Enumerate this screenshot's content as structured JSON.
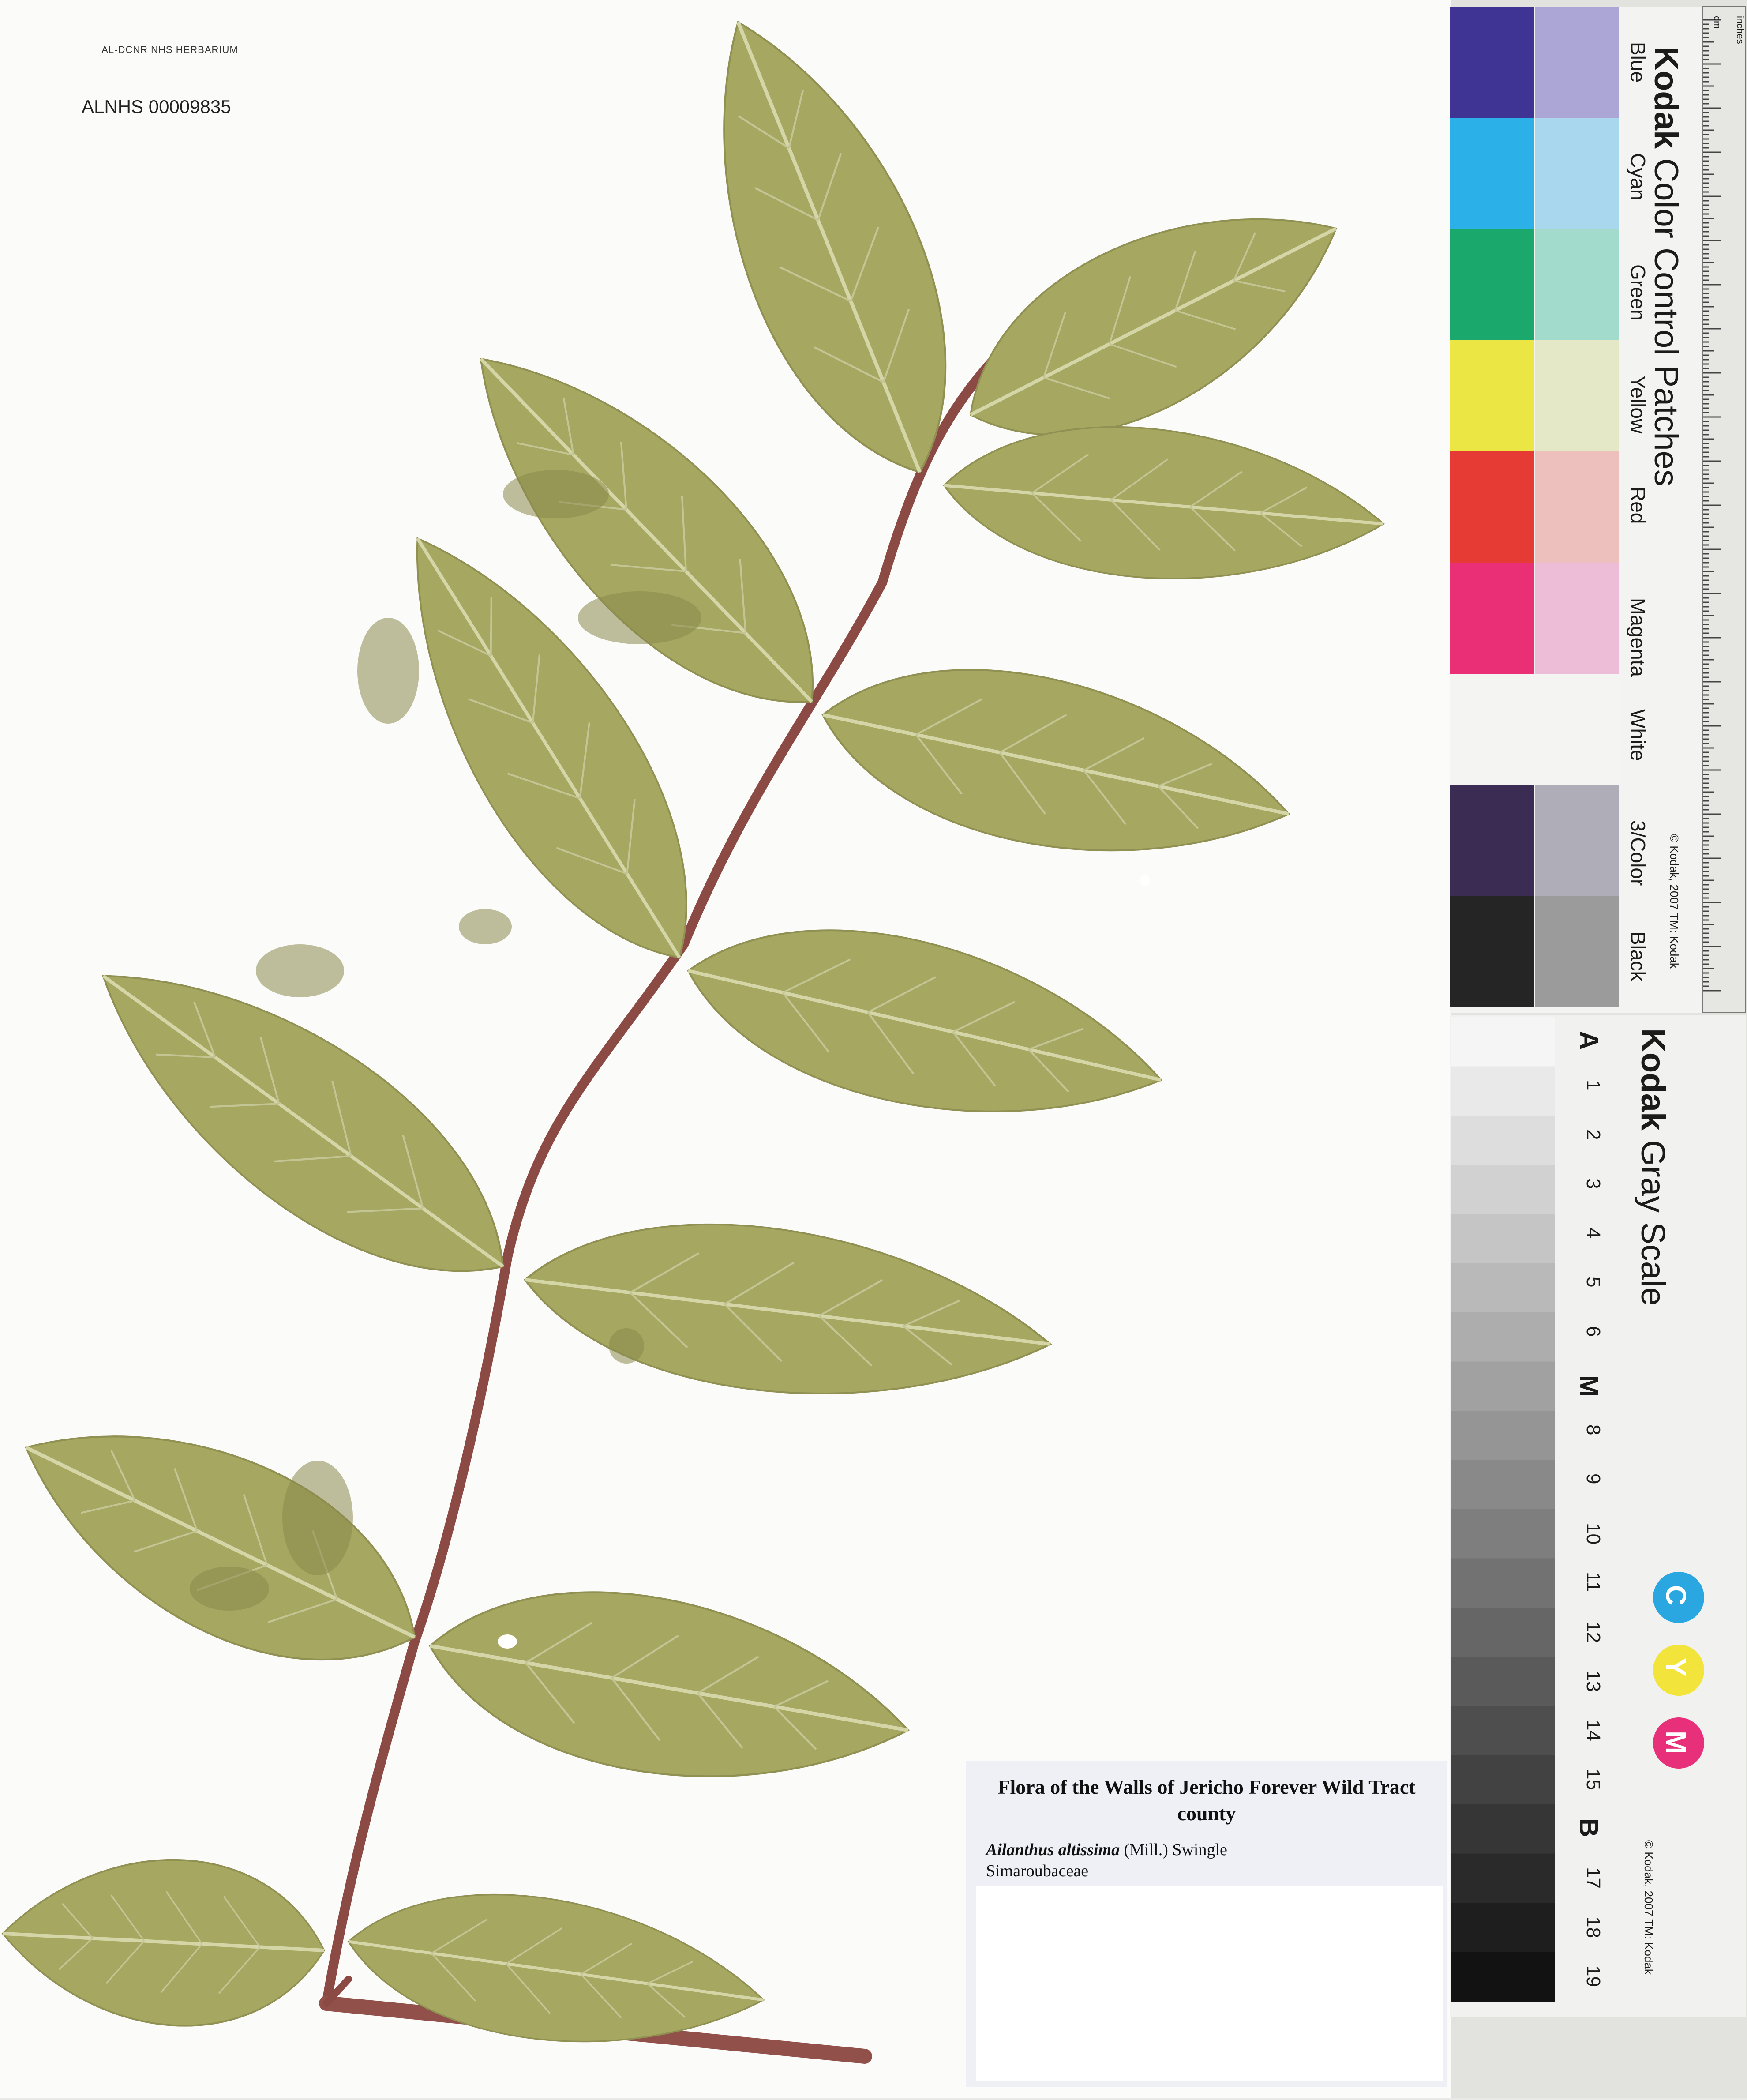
{
  "barcode": {
    "header": "AL-DCNR NHS HERBARIUM",
    "number": "ALNHS 00009835"
  },
  "label": {
    "title": "Flora of the Walls of Jericho Forever Wild Tract county",
    "genus_species": "Ailanthus altissima",
    "authority": "(Mill.) Swingle",
    "family": "Simaroubaceae"
  },
  "color_card": {
    "brand": "Kodak",
    "title": "Color Control Patches",
    "copyright": "© Kodak, 2007 TM: Kodak",
    "ruler_units": [
      "cm",
      "inches"
    ],
    "patches": [
      {
        "name": "Blue",
        "dark": "#3f3393",
        "light": "#aba6d6"
      },
      {
        "name": "Cyan",
        "dark": "#2cb0e8",
        "light": "#a9d8ee"
      },
      {
        "name": "Green",
        "dark": "#1aa86c",
        "light": "#a2dacb"
      },
      {
        "name": "Yellow",
        "dark": "#ece644",
        "light": "#e4e8c6"
      },
      {
        "name": "Red",
        "dark": "#e63b34",
        "light": "#eec0bd"
      },
      {
        "name": "Magenta",
        "dark": "#ea2f77",
        "light": "#edbcd6"
      },
      {
        "name": "White",
        "dark": "#f4f4f2",
        "light": "#f4f4f2"
      },
      {
        "name": "3/Color",
        "dark": "#3a2c52",
        "light": "#aeadb8"
      },
      {
        "name": "Black",
        "dark": "#252525",
        "light": "#9b9b9b"
      }
    ]
  },
  "gray_card": {
    "brand": "Kodak",
    "title": "Gray Scale",
    "copyright": "© Kodak, 2007 TM: Kodak",
    "steps": [
      "A",
      "1",
      "2",
      "3",
      "4",
      "5",
      "6",
      "M",
      "8",
      "9",
      "10",
      "11",
      "12",
      "13",
      "14",
      "15",
      "B",
      "17",
      "18",
      "19"
    ],
    "cmy": [
      {
        "letter": "C",
        "color": "#2aa7e0"
      },
      {
        "letter": "Y",
        "color": "#f2e43a"
      },
      {
        "letter": "M",
        "color": "#e8307a"
      }
    ]
  },
  "colors": {
    "leaf": "#a6a760",
    "leaf_dark": "#8a8a4c",
    "stem": "#8c4a44",
    "sheet": "#fbfbfa"
  }
}
